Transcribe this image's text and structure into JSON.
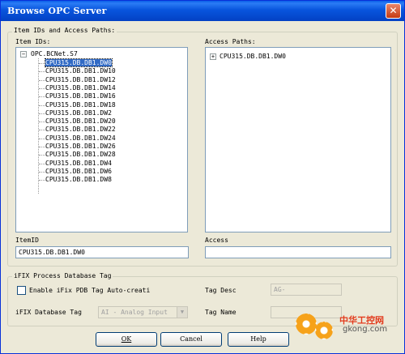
{
  "window": {
    "title": "Browse OPC Server"
  },
  "item_group": {
    "legend": "Item IDs and Access Paths:",
    "item_ids_label": "Item IDs:",
    "access_paths_label": "Access Paths:",
    "tree": {
      "root": "OPC.BCNet.S7",
      "items": [
        "CPU315.DB.DB1.DW0",
        "CPU315.DB.DB1.DW10",
        "CPU315.DB.DB1.DW12",
        "CPU315.DB.DB1.DW14",
        "CPU315.DB.DB1.DW16",
        "CPU315.DB.DB1.DW18",
        "CPU315.DB.DB1.DW2",
        "CPU315.DB.DB1.DW20",
        "CPU315.DB.DB1.DW22",
        "CPU315.DB.DB1.DW24",
        "CPU315.DB.DB1.DW26",
        "CPU315.DB.DB1.DW28",
        "CPU315.DB.DB1.DW4",
        "CPU315.DB.DB1.DW6",
        "CPU315.DB.DB1.DW8"
      ],
      "selected_index": 0
    },
    "access_paths": [
      "CPU315.DB.DB1.DW0"
    ],
    "item_id_label": "ItemID",
    "item_id_value": "CPU315.DB.DB1.DW0",
    "access_label": "Access",
    "access_value": ""
  },
  "ifix_group": {
    "legend": "iFIX Process Database Tag",
    "enable_label": "Enable iFix PDB Tag Auto-creati",
    "enable_checked": false,
    "tag_desc_label": "Tag Desc",
    "tag_desc_value": "AG-",
    "db_tag_label": "iFIX Database Tag",
    "db_tag_selected": "AI - Analog Input",
    "tag_name_label": "Tag Name",
    "tag_name_value": ""
  },
  "buttons": {
    "ok": "OK",
    "cancel": "Cancel",
    "help": "Help"
  },
  "watermark": {
    "line1": "中华工控网",
    "line2": "gkong.com"
  },
  "colors": {
    "title_bar": "#0855dd",
    "selection": "#316ac5",
    "dialog_bg": "#ece9d8",
    "watermark_orange": "#f6a21a",
    "watermark_red": "#e23a1c"
  }
}
